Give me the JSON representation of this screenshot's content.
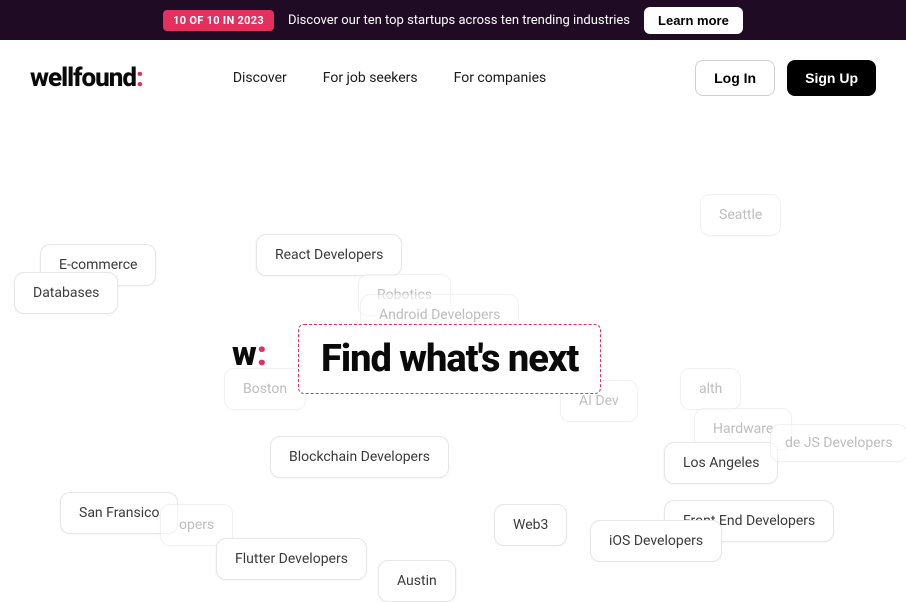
{
  "banner": {
    "badge": "10 OF 10 IN 2023",
    "text": "Discover our ten top startups across ten trending industries",
    "cta": "Learn more"
  },
  "header": {
    "logo_text": "wellfound",
    "logo_suffix": ":",
    "nav": {
      "discover": "Discover",
      "job_seekers": "For job seekers",
      "companies": "For companies"
    },
    "login": "Log In",
    "signup": "Sign Up"
  },
  "hero": {
    "center_logo_w": "w",
    "center_logo_colon": ":",
    "headline": "Find what's next"
  },
  "tags": {
    "seattle": "Seattle",
    "react": "React Developers",
    "ecommerce": "E-commerce",
    "databases": "Databases",
    "robotics": "Robotics",
    "android": "Android Developers",
    "boston": "Boston",
    "aidev": "AI Dev",
    "health": "alth",
    "hardware": "Hardware",
    "los_angeles": "Los Angeles",
    "nodejs": "de JS Developers",
    "blockchain": "Blockchain Developers",
    "san_fran": "San Fransico",
    "opers": "opers",
    "web3": "Web3",
    "frontend": "Front End Developers",
    "ios": "iOS Developers",
    "flutter": "Flutter Developers",
    "austin": "Austin"
  }
}
